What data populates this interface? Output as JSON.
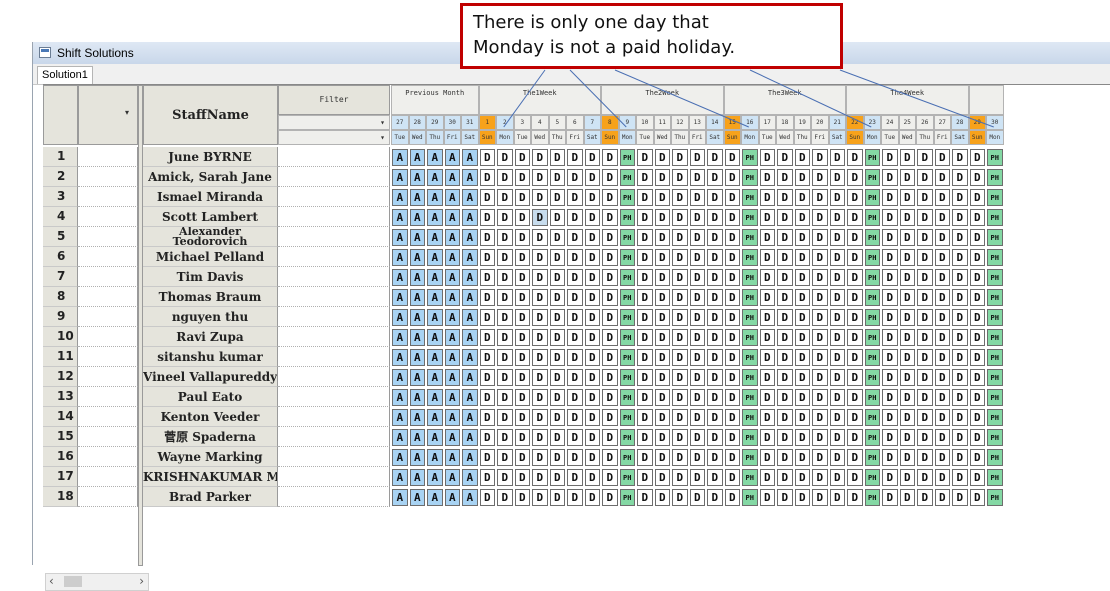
{
  "callout": {
    "line1": "There is only one day that",
    "line2": "Monday is not a paid holiday."
  },
  "window": {
    "title": "Shift Solutions"
  },
  "tabs": [
    "Solution1"
  ],
  "header": {
    "staff_name": "StaffName",
    "filter": "Filter",
    "previous_month": "Previous Month",
    "weeks": [
      "The1Week",
      "The2Week",
      "The3Week",
      "The4Week"
    ]
  },
  "columns": [
    {
      "date": "27",
      "dow": "Tue",
      "type": "prev"
    },
    {
      "date": "28",
      "dow": "Wed",
      "type": "prev"
    },
    {
      "date": "29",
      "dow": "Thu",
      "type": "prev"
    },
    {
      "date": "30",
      "dow": "Fri",
      "type": "prev"
    },
    {
      "date": "31",
      "dow": "Sat",
      "type": "prev"
    },
    {
      "date": "1",
      "dow": "Sun",
      "type": "sun"
    },
    {
      "date": "2",
      "dow": "Mon",
      "type": "mon"
    },
    {
      "date": "3",
      "dow": "Tue",
      "type": "wk"
    },
    {
      "date": "4",
      "dow": "Wed",
      "type": "wk"
    },
    {
      "date": "5",
      "dow": "Thu",
      "type": "wk"
    },
    {
      "date": "6",
      "dow": "Fri",
      "type": "wk"
    },
    {
      "date": "7",
      "dow": "Sat",
      "type": "sat"
    },
    {
      "date": "8",
      "dow": "Sun",
      "type": "sun"
    },
    {
      "date": "9",
      "dow": "Mon",
      "type": "mon"
    },
    {
      "date": "10",
      "dow": "Tue",
      "type": "wk"
    },
    {
      "date": "11",
      "dow": "Wed",
      "type": "wk"
    },
    {
      "date": "12",
      "dow": "Thu",
      "type": "wk"
    },
    {
      "date": "13",
      "dow": "Fri",
      "type": "wk"
    },
    {
      "date": "14",
      "dow": "Sat",
      "type": "sat"
    },
    {
      "date": "15",
      "dow": "Sun",
      "type": "sun"
    },
    {
      "date": "16",
      "dow": "Mon",
      "type": "mon"
    },
    {
      "date": "17",
      "dow": "Tue",
      "type": "wk"
    },
    {
      "date": "18",
      "dow": "Wed",
      "type": "wk"
    },
    {
      "date": "19",
      "dow": "Thu",
      "type": "wk"
    },
    {
      "date": "20",
      "dow": "Fri",
      "type": "wk"
    },
    {
      "date": "21",
      "dow": "Sat",
      "type": "sat"
    },
    {
      "date": "22",
      "dow": "Sun",
      "type": "sun"
    },
    {
      "date": "23",
      "dow": "Mon",
      "type": "mon"
    },
    {
      "date": "24",
      "dow": "Tue",
      "type": "wk"
    },
    {
      "date": "25",
      "dow": "Wed",
      "type": "wk"
    },
    {
      "date": "26",
      "dow": "Thu",
      "type": "wk"
    },
    {
      "date": "27",
      "dow": "Fri",
      "type": "wk"
    },
    {
      "date": "28",
      "dow": "Sat",
      "type": "sat"
    },
    {
      "date": "29",
      "dow": "Sun",
      "type": "sun"
    },
    {
      "date": "30",
      "dow": "Mon",
      "type": "mon"
    }
  ],
  "pattern": [
    "A",
    "A",
    "A",
    "A",
    "A",
    "D",
    "D",
    "D",
    "D",
    "D",
    "D",
    "D",
    "D",
    "PH",
    "D",
    "D",
    "D",
    "D",
    "D",
    "D",
    "PH",
    "D",
    "D",
    "D",
    "D",
    "D",
    "D",
    "PH",
    "D",
    "D",
    "D",
    "D",
    "D",
    "D",
    "PH"
  ],
  "staff": [
    {
      "no": "1",
      "name": "June BYRNE"
    },
    {
      "no": "2",
      "name": "Amick, Sarah Jane"
    },
    {
      "no": "3",
      "name": "Ismael Miranda"
    },
    {
      "no": "4",
      "name": "Scott Lambert"
    },
    {
      "no": "5",
      "name": "Alexander Teodorovich"
    },
    {
      "no": "6",
      "name": "Michael Pelland"
    },
    {
      "no": "7",
      "name": "Tim Davis"
    },
    {
      "no": "8",
      "name": "Thomas Braum"
    },
    {
      "no": "9",
      "name": "nguyen thu"
    },
    {
      "no": "10",
      "name": "Ravi Zupa"
    },
    {
      "no": "11",
      "name": "sitanshu kumar"
    },
    {
      "no": "12",
      "name": "Vineel Vallapureddy"
    },
    {
      "no": "13",
      "name": "Paul Eato"
    },
    {
      "no": "14",
      "name": "Kenton Veeder"
    },
    {
      "no": "15",
      "name": "菅原 Spaderna"
    },
    {
      "no": "16",
      "name": "Wayne Marking"
    },
    {
      "no": "17",
      "name": "KRISHNAKUMAR MANI"
    },
    {
      "no": "18",
      "name": "Brad Parker"
    }
  ],
  "colors": {
    "sun": "#f7a21b",
    "mon": "#cfe4f5",
    "sat": "#cfe4f5",
    "prev": "#cfe4f5",
    "wk": "#efefec",
    "cell_A": "#a8d3f3",
    "cell_PH": "#84d8a4"
  },
  "scroll": {
    "left": "‹",
    "right": "›"
  }
}
